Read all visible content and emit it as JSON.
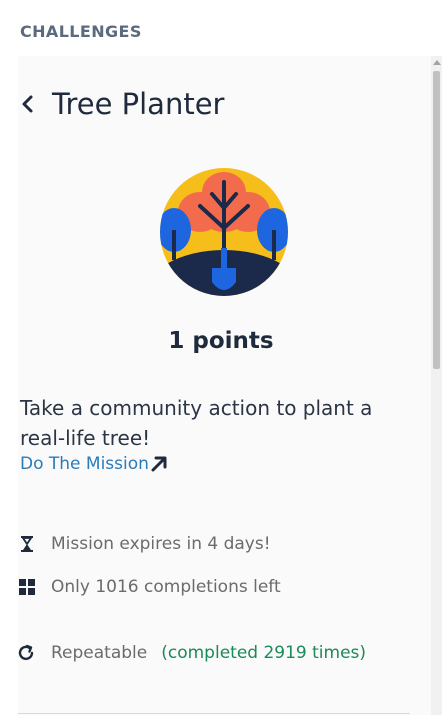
{
  "section": {
    "header": "CHALLENGES"
  },
  "challenge": {
    "title": "Tree Planter",
    "points": "1 points",
    "description": "Take a community action to plant a real-life tree!",
    "mission_link": "Do The Mission",
    "expires": "Mission expires in 4 days!",
    "completions_left": "Only 1016 completions left",
    "repeatable": "Repeatable",
    "completed": "(completed 2919 times)"
  },
  "icons": {
    "back": "chevron-left-icon",
    "badge": "tree-planter-badge",
    "external_link": "arrow-up-right-icon",
    "expires": "hourglass-icon",
    "completions": "grid-icon",
    "repeat": "repeat-icon"
  },
  "colors": {
    "link": "#2b7bb8",
    "completed": "#1a8a57",
    "title": "#1f2a3c",
    "badge_yellow": "#f5be1b",
    "badge_orange": "#f26b4c",
    "badge_blue": "#1e66e0",
    "badge_navy": "#1b2a4a"
  }
}
